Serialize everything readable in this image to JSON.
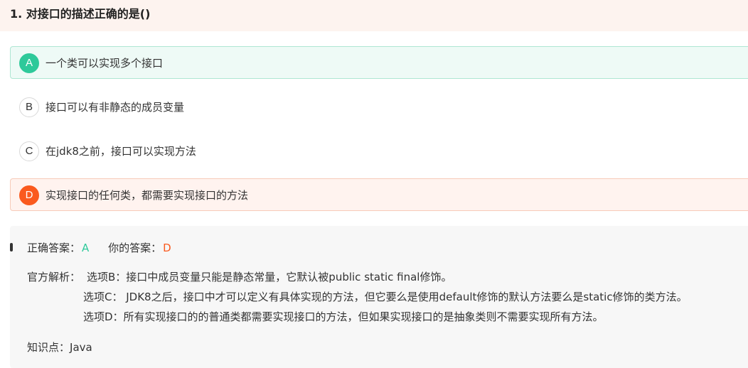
{
  "question": {
    "title": "1. 对接口的描述正确的是()"
  },
  "options": [
    {
      "letter": "A",
      "text": "一个类可以实现多个接口",
      "state": "correct"
    },
    {
      "letter": "B",
      "text": "接口可以有非静态的成员变量",
      "state": "normal"
    },
    {
      "letter": "C",
      "text": "在jdk8之前，接口可以实现方法",
      "state": "normal"
    },
    {
      "letter": "D",
      "text": "实现接口的任何类，都需要实现接口的方法",
      "state": "wrong"
    }
  ],
  "result": {
    "correct_label": "正确答案：",
    "correct_value": "A",
    "yours_label": "你的答案：",
    "yours_value": "D"
  },
  "analysis": {
    "label": "官方解析：",
    "lines": [
      "选项B：接口中成员变量只能是静态常量，它默认被public static final修饰。",
      "选项C： JDK8之后，接口中才可以定义有具体实现的方法，但它要么是使用default修饰的默认方法要么是static修饰的类方法。",
      "选项D：所有实现接口的的普通类都需要实现接口的方法，但如果实现接口的是抽象类则不需要实现所有方法。"
    ]
  },
  "knowledge": {
    "label": "知识点：",
    "value": "Java"
  },
  "colors": {
    "correct": "#2ec99a",
    "wrong": "#fa5a1e",
    "header_bg": "#fdf3ef",
    "panel_bg": "#f7f7f7"
  }
}
